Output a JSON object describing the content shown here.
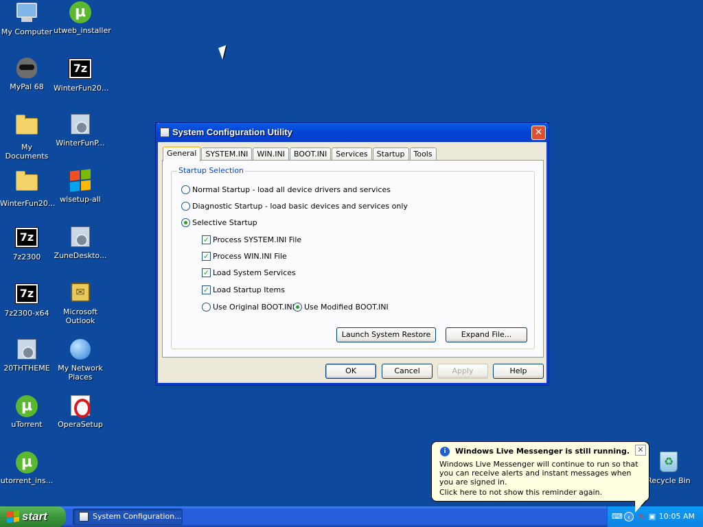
{
  "desktop": {
    "icons": [
      {
        "label": "My Computer",
        "icon": "my-computer-icon"
      },
      {
        "label": "utweb_installer",
        "icon": "utorrent-icon"
      },
      {
        "label": "MyPal 68",
        "icon": "mypal-icon"
      },
      {
        "label": "WinterFun20...",
        "icon": "7zip-icon"
      },
      {
        "label": "My Documents",
        "icon": "my-documents-icon"
      },
      {
        "label": "WinterFunP...",
        "icon": "installer-icon"
      },
      {
        "label": "WinterFun20...",
        "icon": "folder-icon"
      },
      {
        "label": "wlsetup-all",
        "icon": "windows-flag-icon"
      },
      {
        "label": "7z2300",
        "icon": "7zip-icon"
      },
      {
        "label": "ZuneDeskto...",
        "icon": "installer-icon"
      },
      {
        "label": "7z2300-x64",
        "icon": "7zip-icon"
      },
      {
        "label": "Microsoft Outlook",
        "icon": "outlook-icon"
      },
      {
        "label": "20THTHEME",
        "icon": "installer-icon"
      },
      {
        "label": "My Network Places",
        "icon": "network-places-icon"
      },
      {
        "label": "uTorrent",
        "icon": "utorrent-icon"
      },
      {
        "label": "OperaSetup",
        "icon": "opera-icon"
      },
      {
        "label": "utorrent_ins...",
        "icon": "utorrent-icon"
      },
      {
        "label": "Recycle Bin",
        "icon": "recycle-bin-icon"
      }
    ]
  },
  "dialog": {
    "title": "System Configuration Utility",
    "close_glyph": "✕",
    "tabs": [
      "General",
      "SYSTEM.INI",
      "WIN.INI",
      "BOOT.INI",
      "Services",
      "Startup",
      "Tools"
    ],
    "active_tab": "General",
    "group_title": "Startup Selection",
    "radios": {
      "normal": "Normal Startup - load all device drivers and services",
      "diagnostic": "Diagnostic Startup - load basic devices and services only",
      "selective": "Selective Startup",
      "selected": "selective"
    },
    "checks": {
      "system_ini": "Process SYSTEM.INI File",
      "win_ini": "Process WIN.INI File",
      "services": "Load System Services",
      "startup": "Load Startup Items",
      "check_glyph": "✓"
    },
    "boot": {
      "original": "Use Original BOOT.INI",
      "modified": "Use Modified BOOT.INI",
      "selected": "modified"
    },
    "buttons": {
      "restore": "Launch System Restore",
      "expand": "Expand File...",
      "ok": "OK",
      "cancel": "Cancel",
      "apply": "Apply",
      "help": "Help"
    }
  },
  "balloon": {
    "info_glyph": "i",
    "title": "Windows Live Messenger is still running.",
    "close_glyph": "✕",
    "body": "Windows Live Messenger will continue to run so that you can receive alerts and instant messages when you are signed in.",
    "link": "Click here to not show this reminder again."
  },
  "taskbar": {
    "start_label": "start",
    "task_label": "System Configuration...",
    "clock": "10:05 AM"
  },
  "colors": {
    "desktop": "#0d4a9e",
    "titlebar": "#0245d4",
    "taskbar": "#245edb",
    "start": "#3c963c"
  }
}
